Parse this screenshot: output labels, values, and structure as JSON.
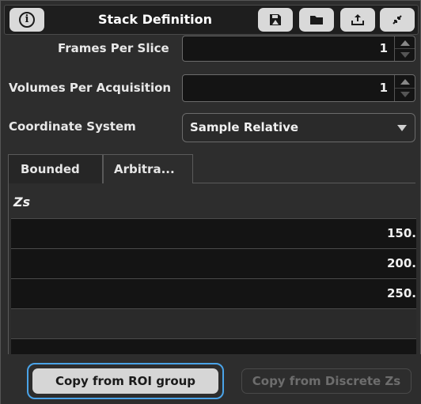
{
  "title": "Stack Definition",
  "toolbar": {
    "info_icon": "info-icon",
    "save_icon": "save-icon",
    "open_icon": "folder-open-icon",
    "export_icon": "export-icon",
    "collapse_icon": "collapse-icon"
  },
  "fields": {
    "frames_per_slice": {
      "label": "Frames Per Slice",
      "value": "1"
    },
    "volumes_per_acquisition": {
      "label": "Volumes Per Acquisition",
      "value": "1"
    },
    "coordinate_system": {
      "label": "Coordinate System",
      "value": "Sample Relative"
    }
  },
  "tabs": [
    {
      "label": "Bounded"
    },
    {
      "label": "Arbitra..."
    }
  ],
  "zs": {
    "header": "Zs",
    "values": [
      "150.",
      "200.",
      "250."
    ]
  },
  "buttons": {
    "copy_roi": "Copy from ROI group",
    "copy_discrete": "Copy from Discrete Zs"
  },
  "colors": {
    "focus_ring": "#4aa3e8",
    "panel_bg": "#2d2d2d",
    "field_bg": "#141414"
  }
}
